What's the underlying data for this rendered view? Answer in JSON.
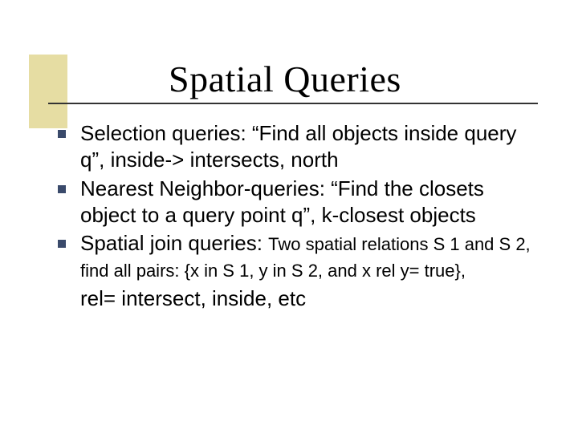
{
  "slide": {
    "title": "Spatial Queries",
    "bullets": [
      {
        "text": "Selection queries: “Find all objects inside query q”, inside-> intersects, north"
      },
      {
        "text": "Nearest Neighbor-queries: “Find the closets object to a query point q”, k-closest objects"
      },
      {
        "lead": "Spatial join queries: ",
        "sub": "Two spatial relations S 1 and S 2, find all pairs: {x in S 1, y in S 2, and x rel y= true},"
      }
    ],
    "tail": "rel= intersect, inside, etc"
  },
  "colors": {
    "accent_box": "#e6dda3",
    "bullet_square": "#3a4a6b"
  }
}
